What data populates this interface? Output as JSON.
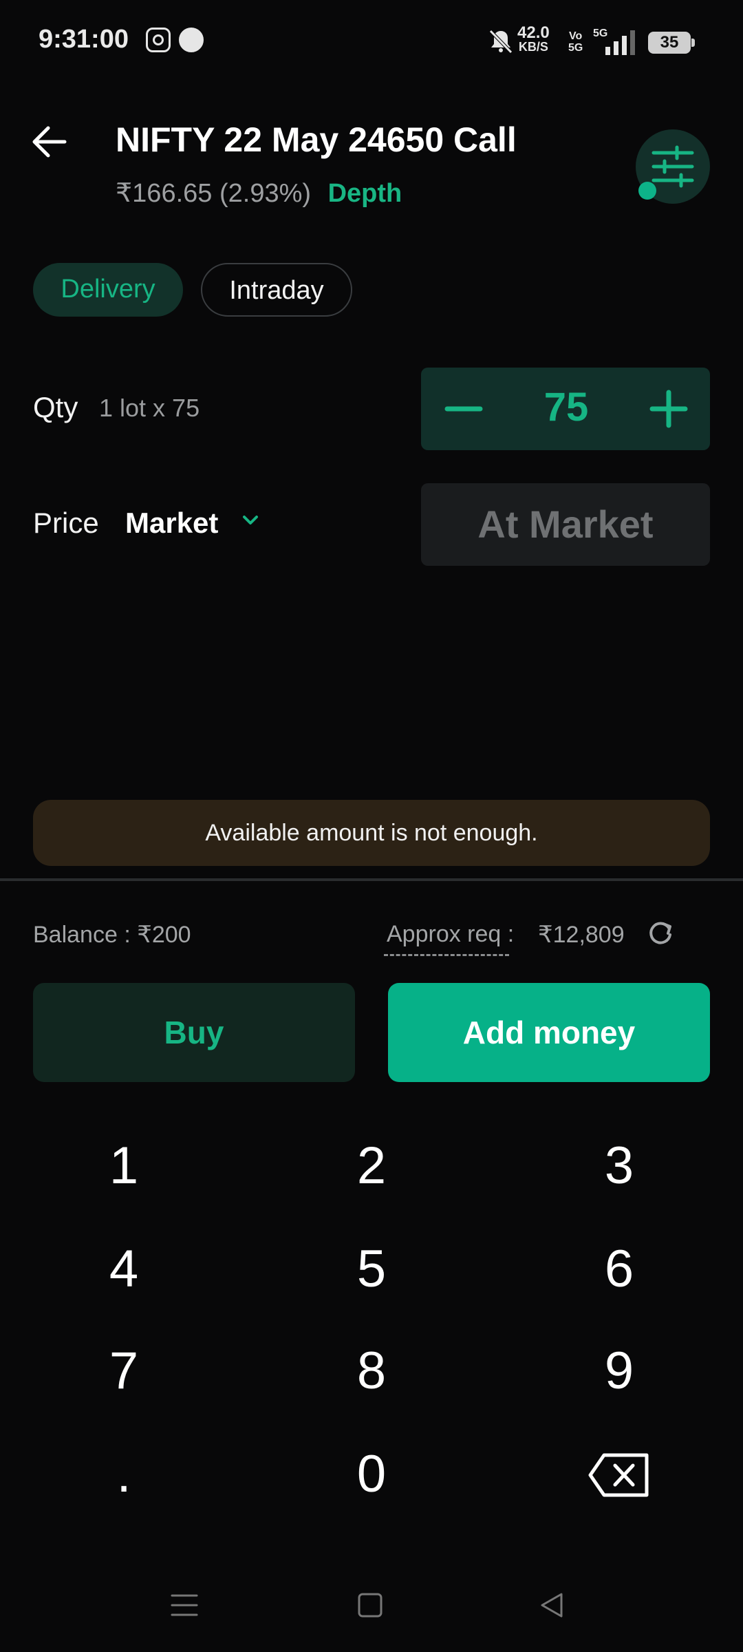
{
  "status_bar": {
    "time": "9:31:00",
    "net_speed_value": "42.0",
    "net_speed_unit": "KB/S",
    "vo_label": "Vo",
    "net_5g_label": "5G",
    "signal_label": "5G",
    "battery": "35"
  },
  "header": {
    "title": "NIFTY 22 May 24650 Call",
    "price": "₹166.65",
    "change": "(2.93%)",
    "depth_link": "Depth"
  },
  "product_types": [
    {
      "label": "Delivery",
      "selected": true
    },
    {
      "label": "Intraday",
      "selected": false
    }
  ],
  "qty": {
    "label": "Qty",
    "sub": "1 lot x 75",
    "value": "75"
  },
  "price": {
    "label": "Price",
    "type": "Market",
    "input_value": "At Market"
  },
  "warning": "Available amount is not enough.",
  "balance": {
    "balance_text": "Balance : ₹200",
    "approx_label": "Approx req :",
    "approx_value": "₹12,809"
  },
  "actions": {
    "buy": "Buy",
    "add_money": "Add money"
  },
  "keypad": [
    "1",
    "2",
    "3",
    "4",
    "5",
    "6",
    "7",
    "8",
    "9",
    ".",
    "0"
  ],
  "colors": {
    "accent": "#17b584",
    "primary_button": "#06b188",
    "warning_bg": "#2c2215",
    "background": "#080809"
  }
}
